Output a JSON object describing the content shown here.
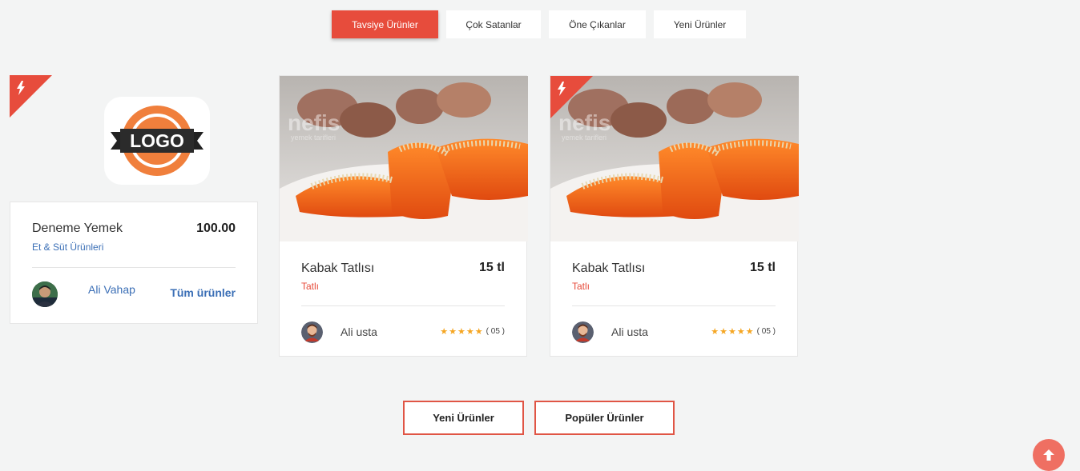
{
  "tabs": [
    {
      "label": "Tavsiye Ürünler",
      "active": true
    },
    {
      "label": "Çok Satanlar",
      "active": false
    },
    {
      "label": "Öne Çıkanlar",
      "active": false
    },
    {
      "label": "Yeni Ürünler",
      "active": false
    }
  ],
  "store_card": {
    "logo_text": "LOGO",
    "title": "Deneme Yemek",
    "price": "100.00",
    "category": "Et & Süt Ürünleri",
    "author": "Ali Vahap",
    "all_products_link": "Tüm ürünler"
  },
  "products": [
    {
      "title": "Kabak Tatlısı",
      "price": "15 tl",
      "category": "Tatlı",
      "author": "Ali usta",
      "rating": 5,
      "review_count": "05",
      "image_watermark": "nefis",
      "image_watermark_sub": "yemek tarifleri"
    },
    {
      "title": "Kabak Tatlısı",
      "price": "15 tl",
      "category": "Tatlı",
      "author": "Ali usta",
      "rating": 5,
      "review_count": "05",
      "image_watermark": "nefis",
      "image_watermark_sub": "yemek tarifleri"
    }
  ],
  "bottom_buttons": {
    "new_products": "Yeni Ürünler",
    "popular_products": "Popüler Ürünler"
  },
  "colors": {
    "accent": "#e74c3c",
    "category_blue": "#3b6fb6",
    "category_red": "#e74c3c",
    "star": "#f5a623",
    "background": "#f3f4f4"
  },
  "icons": {
    "ribbon": "bolt-icon",
    "scroll_top": "arrow-up-icon"
  }
}
